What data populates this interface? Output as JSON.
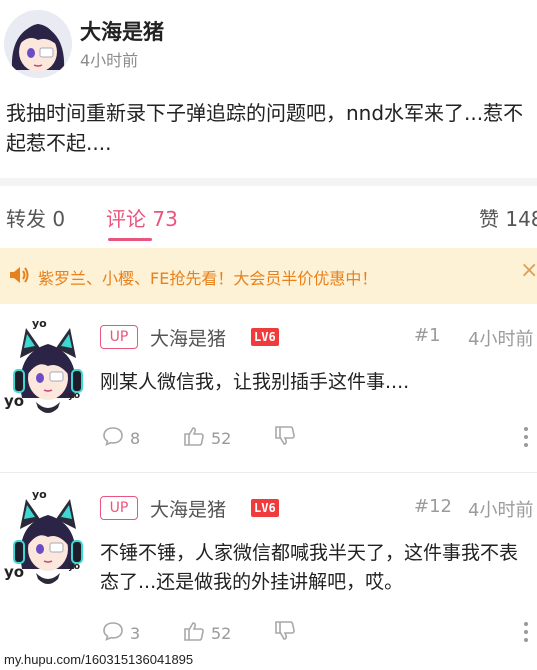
{
  "post": {
    "author": "大海是猪",
    "time": "4小时前",
    "body": "我抽时间重新录下子弹追踪的问题吧，nnd水军来了...惹不起惹不起...."
  },
  "tabs": {
    "repost": "转发 0",
    "comments": "评论 73",
    "likes": "赞 148"
  },
  "promo": {
    "text": "紫罗兰、小樱、FE抢先看！大会员半价优惠中！",
    "close": "×"
  },
  "comments": [
    {
      "badge": "UP",
      "author": "大海是猪",
      "level": "LV6",
      "floor": "#1",
      "time": "4小时前",
      "text": "刚某人微信我，让我别插手这件事....",
      "replies": "8",
      "likes": "52"
    },
    {
      "badge": "UP",
      "author": "大海是猪",
      "level": "LV6",
      "floor": "#12",
      "time": "4小时前",
      "text": "不锤不锤，人家微信都喊我半天了，这件事我不表态了...还是做我的外挂讲解吧，哎。",
      "replies": "3",
      "likes": "52"
    }
  ],
  "watermark": "my.hupu.com/160315136041895",
  "colors": {
    "accent": "#e9567d",
    "promo_bg": "#fdf1d6",
    "promo_text": "#e8811b",
    "level_badge": "#ef3b3b"
  },
  "icons": {
    "promo": "speaker-icon",
    "reply": "comment-bubble-icon",
    "like": "thumbs-up-icon",
    "dislike": "thumbs-down-icon",
    "more": "more-vertical-icon"
  }
}
